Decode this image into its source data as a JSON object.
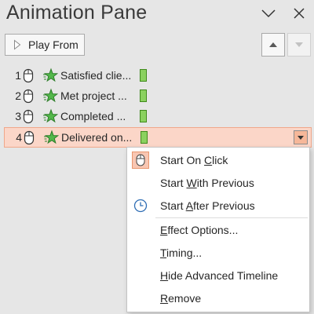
{
  "pane": {
    "title": "Animation Pane",
    "play_button_label": "Play From",
    "minimize_icon": "chevron-down-icon",
    "close_icon": "close-icon",
    "move_up_icon": "triangle-up-icon",
    "move_down_icon": "triangle-down-icon"
  },
  "animations": [
    {
      "number": "1",
      "label": "Satisfied clie...",
      "trigger_icon": "mouse-icon",
      "effect_icon": "star-entrance-icon",
      "selected": false
    },
    {
      "number": "2",
      "label": "Met project ...",
      "trigger_icon": "mouse-icon",
      "effect_icon": "star-entrance-icon",
      "selected": false
    },
    {
      "number": "3",
      "label": "Completed ...",
      "trigger_icon": "mouse-icon",
      "effect_icon": "star-entrance-icon",
      "selected": false
    },
    {
      "number": "4",
      "label": "Delivered on...",
      "trigger_icon": "mouse-icon",
      "effect_icon": "star-entrance-icon",
      "selected": true
    }
  ],
  "context_menu": {
    "start_on_click": {
      "pre": "Start On ",
      "key": "C",
      "post": "lick",
      "checked": true
    },
    "start_with_previous": {
      "pre": "Start ",
      "key": "W",
      "post": "ith Previous"
    },
    "start_after_previous": {
      "pre": "Start ",
      "key": "A",
      "post": "fter Previous"
    },
    "effect_options": {
      "pre": "",
      "key": "E",
      "post": "ffect Options..."
    },
    "timing": {
      "pre": "",
      "key": "T",
      "post": "iming..."
    },
    "hide_advanced_timeline": {
      "pre": "",
      "key": "H",
      "post": "ide Advanced Timeline"
    },
    "remove": {
      "pre": "",
      "key": "R",
      "post": "emove"
    }
  },
  "colors": {
    "pane_background": "#e6e6e6",
    "selected_row": "#fbd6c8",
    "timeline_bar": "#8bd15f",
    "effect_star": "#3a9b35"
  }
}
